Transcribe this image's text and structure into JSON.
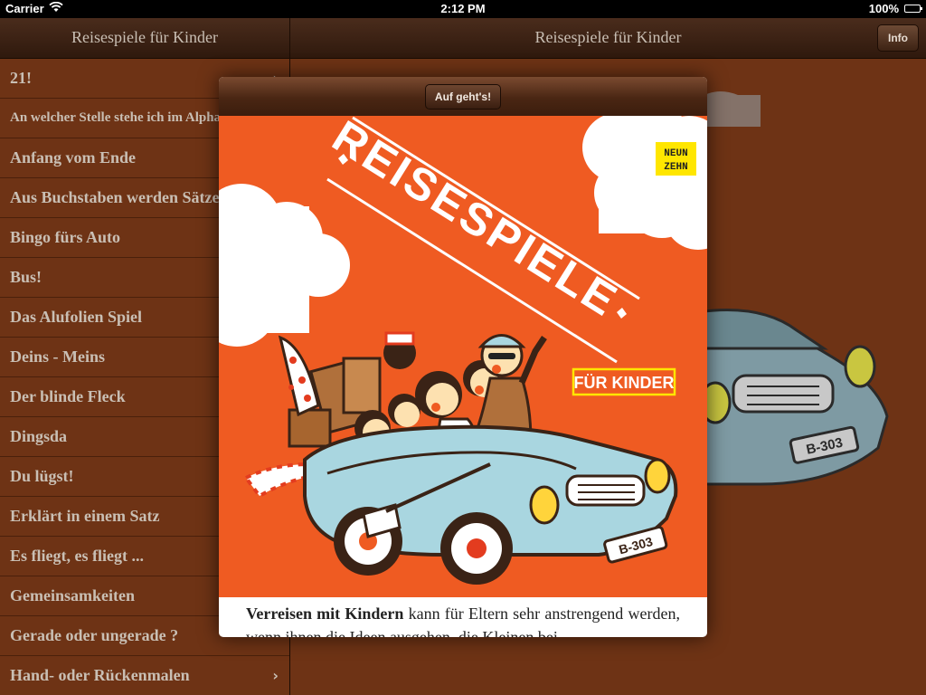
{
  "status_bar": {
    "carrier": "Carrier",
    "time": "2:12 PM",
    "battery": "100%",
    "battery_level": 1.0
  },
  "master_nav": {
    "title": "Reisespiele für Kinder"
  },
  "detail_nav": {
    "title": "Reisespiele für Kinder",
    "info_label": "Info"
  },
  "games": [
    "21!",
    "An welcher Stelle stehe ich im Alphabet?",
    "Anfang vom Ende",
    "Aus Buchstaben werden Sätze",
    "Bingo fürs Auto",
    "Bus!",
    "Das Alufolien Spiel",
    "Deins - Meins",
    "Der blinde Fleck",
    "Dingsda",
    "Du lügst!",
    "Erklärt in einem Satz",
    "Es fliegt, es fliegt ...",
    "Gemeinsamkeiten",
    "Gerade oder ungerade ?",
    "Hand- oder Rückenmalen"
  ],
  "modal": {
    "button_label": "Auf geht's!",
    "cover": {
      "title": "REISESPIELE",
      "subtitle": "FÜR KINDER",
      "publisher_line1": "NEUN",
      "publisher_line2": "ZEHN",
      "plate": "B-303"
    },
    "intro_bold": "Verreisen mit Kindern",
    "intro_text": " kann für Eltern sehr anstrengend werden, wenn ihnen die Ideen ausgehen, die Kleinen bei"
  },
  "colors": {
    "accent_orange": "#ef5b22",
    "list_brown": "#6e3315",
    "car_blue": "#a9d6e0",
    "publisher_yellow": "#ffe600"
  }
}
